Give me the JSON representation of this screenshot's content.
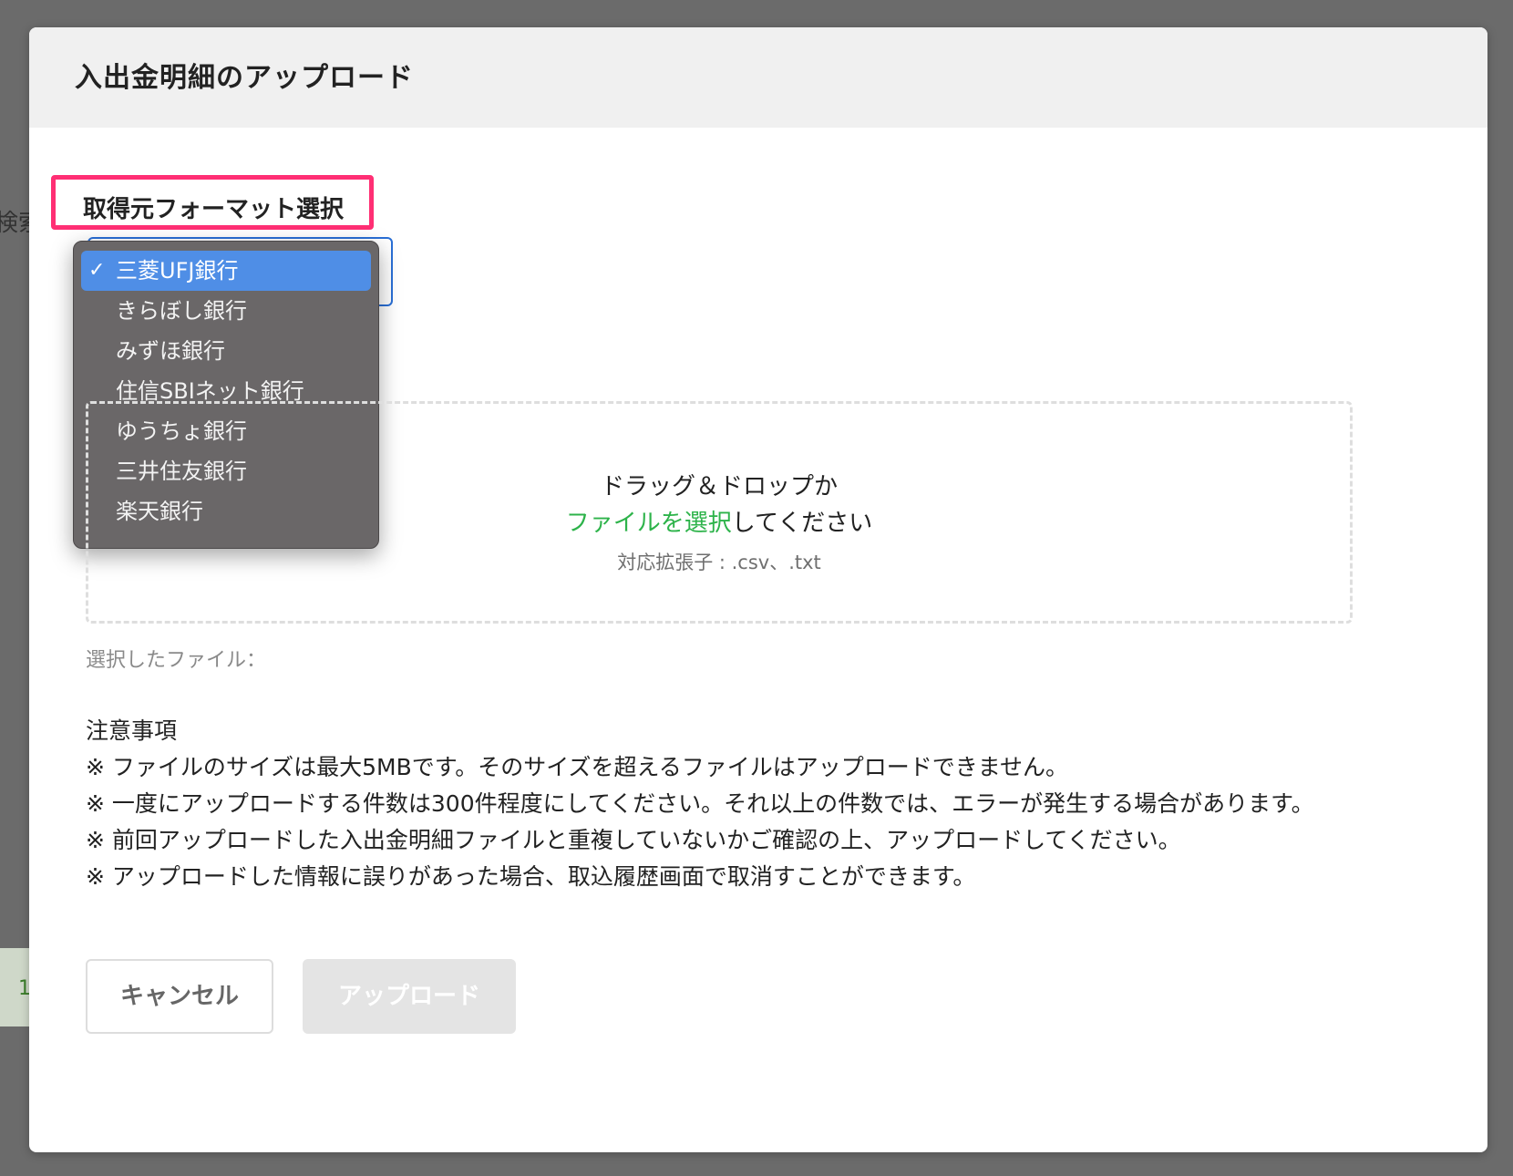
{
  "background": {
    "left_text": "検索",
    "left_number": "1"
  },
  "modal": {
    "title": "入出金明細のアップロード"
  },
  "format_select": {
    "label": "取得元フォーマット選択",
    "selected": "三菱UFJ銀行",
    "options": [
      "三菱UFJ銀行",
      "きらぼし銀行",
      "みずほ銀行",
      "住信SBIネット銀行",
      "ゆうちょ銀行",
      "三井住友銀行",
      "楽天銀行"
    ],
    "check_mark": "✓"
  },
  "dropzone": {
    "line1": "ドラッグ＆ドロップか",
    "link_text": "ファイルを選択",
    "line2_suffix": "してください",
    "extensions": "対応拡張子 : .csv、.txt"
  },
  "selected_file_label": "選択したファイル：",
  "notes": {
    "heading": "注意事項",
    "items": [
      "※ ファイルのサイズは最大5MBです。そのサイズを超えるファイルはアップロードできません。",
      "※ 一度にアップロードする件数は300件程度にしてください。それ以上の件数では、エラーが発生する場合があります。",
      "※ 前回アップロードした入出金明細ファイルと重複していないかご確認の上、アップロードしてください。",
      "※ アップロードした情報に誤りがあった場合、取込履歴画面で取消すことができます。"
    ]
  },
  "buttons": {
    "cancel": "キャンセル",
    "upload": "アップロード"
  },
  "colors": {
    "highlight_border": "#ff2f74",
    "link_green": "#2db34a",
    "selected_option_bg": "#4f8ee6",
    "dropdown_bg": "#6a6768"
  }
}
